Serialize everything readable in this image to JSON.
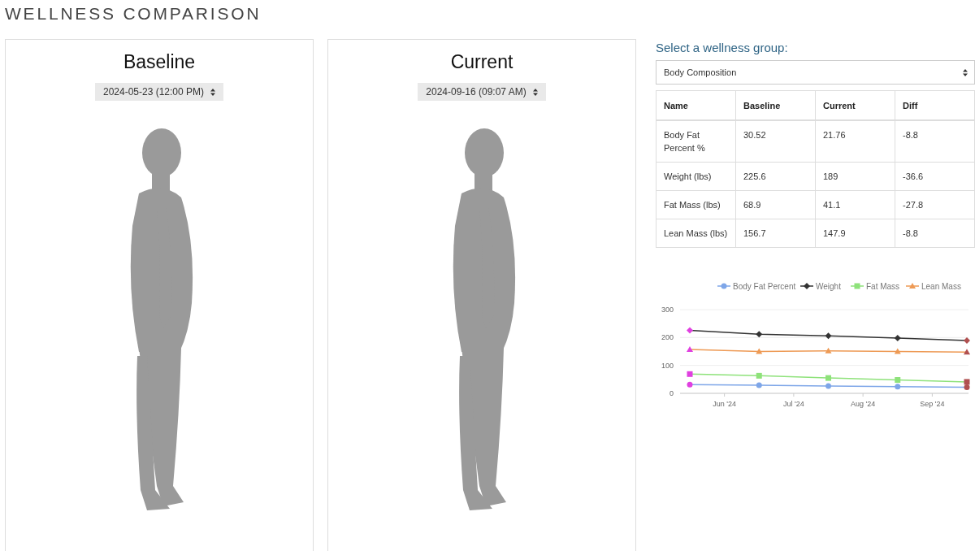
{
  "title": "WELLNESS COMPARISON",
  "scans": [
    {
      "heading": "Baseline",
      "date": "2024-05-23 (12:00 PM)"
    },
    {
      "heading": "Current",
      "date": "2024-09-16 (09:07 AM)"
    }
  ],
  "group_select": {
    "label": "Select a wellness group:",
    "value": "Body Composition"
  },
  "table": {
    "columns": [
      "Name",
      "Baseline",
      "Current",
      "Diff"
    ],
    "rows": [
      [
        "Body Fat Percent %",
        "30.52",
        "21.76",
        "-8.8"
      ],
      [
        "Weight (lbs)",
        "225.6",
        "189",
        "-36.6"
      ],
      [
        "Fat Mass (lbs)",
        "68.9",
        "41.1",
        "-27.8"
      ],
      [
        "Lean Mass (lbs)",
        "156.7",
        "147.9",
        "-8.8"
      ]
    ]
  },
  "chart_data": {
    "type": "line",
    "legend": true,
    "categories": [
      null,
      "Jun '24",
      null,
      "Jul '24",
      null,
      "Aug '24",
      null,
      "Sep '24",
      null
    ],
    "ylim": [
      0,
      300
    ],
    "yticks": [
      0,
      100,
      200,
      300
    ],
    "series": [
      {
        "name": "Body Fat Percent",
        "color": "#7ea6e8",
        "marker": "circle",
        "values": [
          31,
          null,
          29,
          null,
          26,
          null,
          24,
          null,
          22
        ]
      },
      {
        "name": "Weight",
        "color": "#333333",
        "marker": "diamond",
        "values": [
          226,
          null,
          212,
          null,
          206,
          null,
          198,
          null,
          189
        ]
      },
      {
        "name": "Fat Mass",
        "color": "#8ee27a",
        "marker": "square",
        "values": [
          69,
          null,
          63,
          null,
          55,
          null,
          48,
          null,
          41
        ]
      },
      {
        "name": "Lean Mass",
        "color": "#ee9a55",
        "marker": "triangle",
        "values": [
          157,
          null,
          150,
          null,
          152,
          null,
          150,
          null,
          148
        ]
      }
    ]
  }
}
